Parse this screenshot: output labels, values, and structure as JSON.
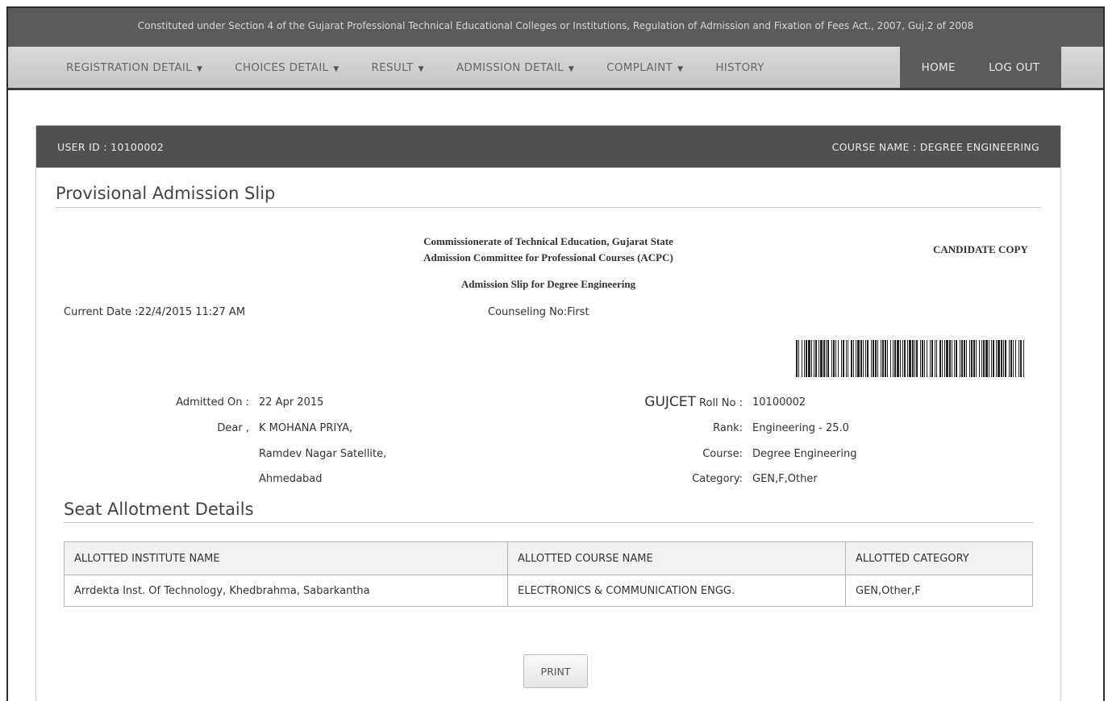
{
  "banner": {
    "text": "Constituted under Section 4 of the Gujarat Professional Technical Educational Colleges or Institutions, Regulation of Admission and Fixation of Fees Act., 2007, Guj.2 of 2008"
  },
  "nav": {
    "items": [
      {
        "label": "REGISTRATION DETAIL",
        "dropdown": true
      },
      {
        "label": "CHOICES DETAIL",
        "dropdown": true
      },
      {
        "label": "RESULT",
        "dropdown": true
      },
      {
        "label": "ADMISSION DETAIL",
        "dropdown": true
      },
      {
        "label": "COMPLAINT",
        "dropdown": true
      },
      {
        "label": "HISTORY",
        "dropdown": false
      }
    ],
    "home": "HOME",
    "logout": "LOG OUT"
  },
  "panel": {
    "user_id": "USER ID : 10100002",
    "course_name": "COURSE NAME : DEGREE ENGINEERING"
  },
  "slip": {
    "title": "Provisional Admission  Slip",
    "org_line1": "Commissionerate of Technical Education, Gujarat State",
    "org_line2": "Admission Committee for Professional Courses (ACPC)",
    "subtitle": "Admission  Slip for Degree Engineering",
    "candidate_copy": "CANDIDATE COPY",
    "current_date": "Current Date :22/4/2015 11:27 AM",
    "counseling": "Counseling No:First"
  },
  "candidate": {
    "admitted_on_label": "Admitted On :",
    "admitted_on": "22 Apr 2015",
    "dear_label": "Dear ,",
    "name": "K MOHANA PRIYA,",
    "address1": "Ramdev Nagar Satellite,",
    "address2": "Ahmedabad",
    "gujcet_prefix": "GUJCET",
    "roll_label": "Roll No :",
    "roll_no": "10100002",
    "rank_label": "Rank:",
    "rank": "Engineering - 25.0",
    "course_label": "Course:",
    "course": "Degree Engineering",
    "category_label": "Category:",
    "category": "GEN,F,Other"
  },
  "seat": {
    "title": "Seat Allotment Details",
    "headers": [
      "ALLOTTED INSTITUTE NAME",
      "ALLOTTED COURSE NAME",
      "ALLOTTED CATEGORY"
    ],
    "rows": [
      [
        "Arrdekta Inst. Of Technology, Khedbrahma, Sabarkantha",
        "ELECTRONICS & COMMUNICATION ENGG.",
        "GEN,Other,F"
      ]
    ]
  },
  "print_label": "PRINT",
  "icons": {
    "dropdown": "caret-down-icon",
    "barcode": "barcode-icon"
  }
}
